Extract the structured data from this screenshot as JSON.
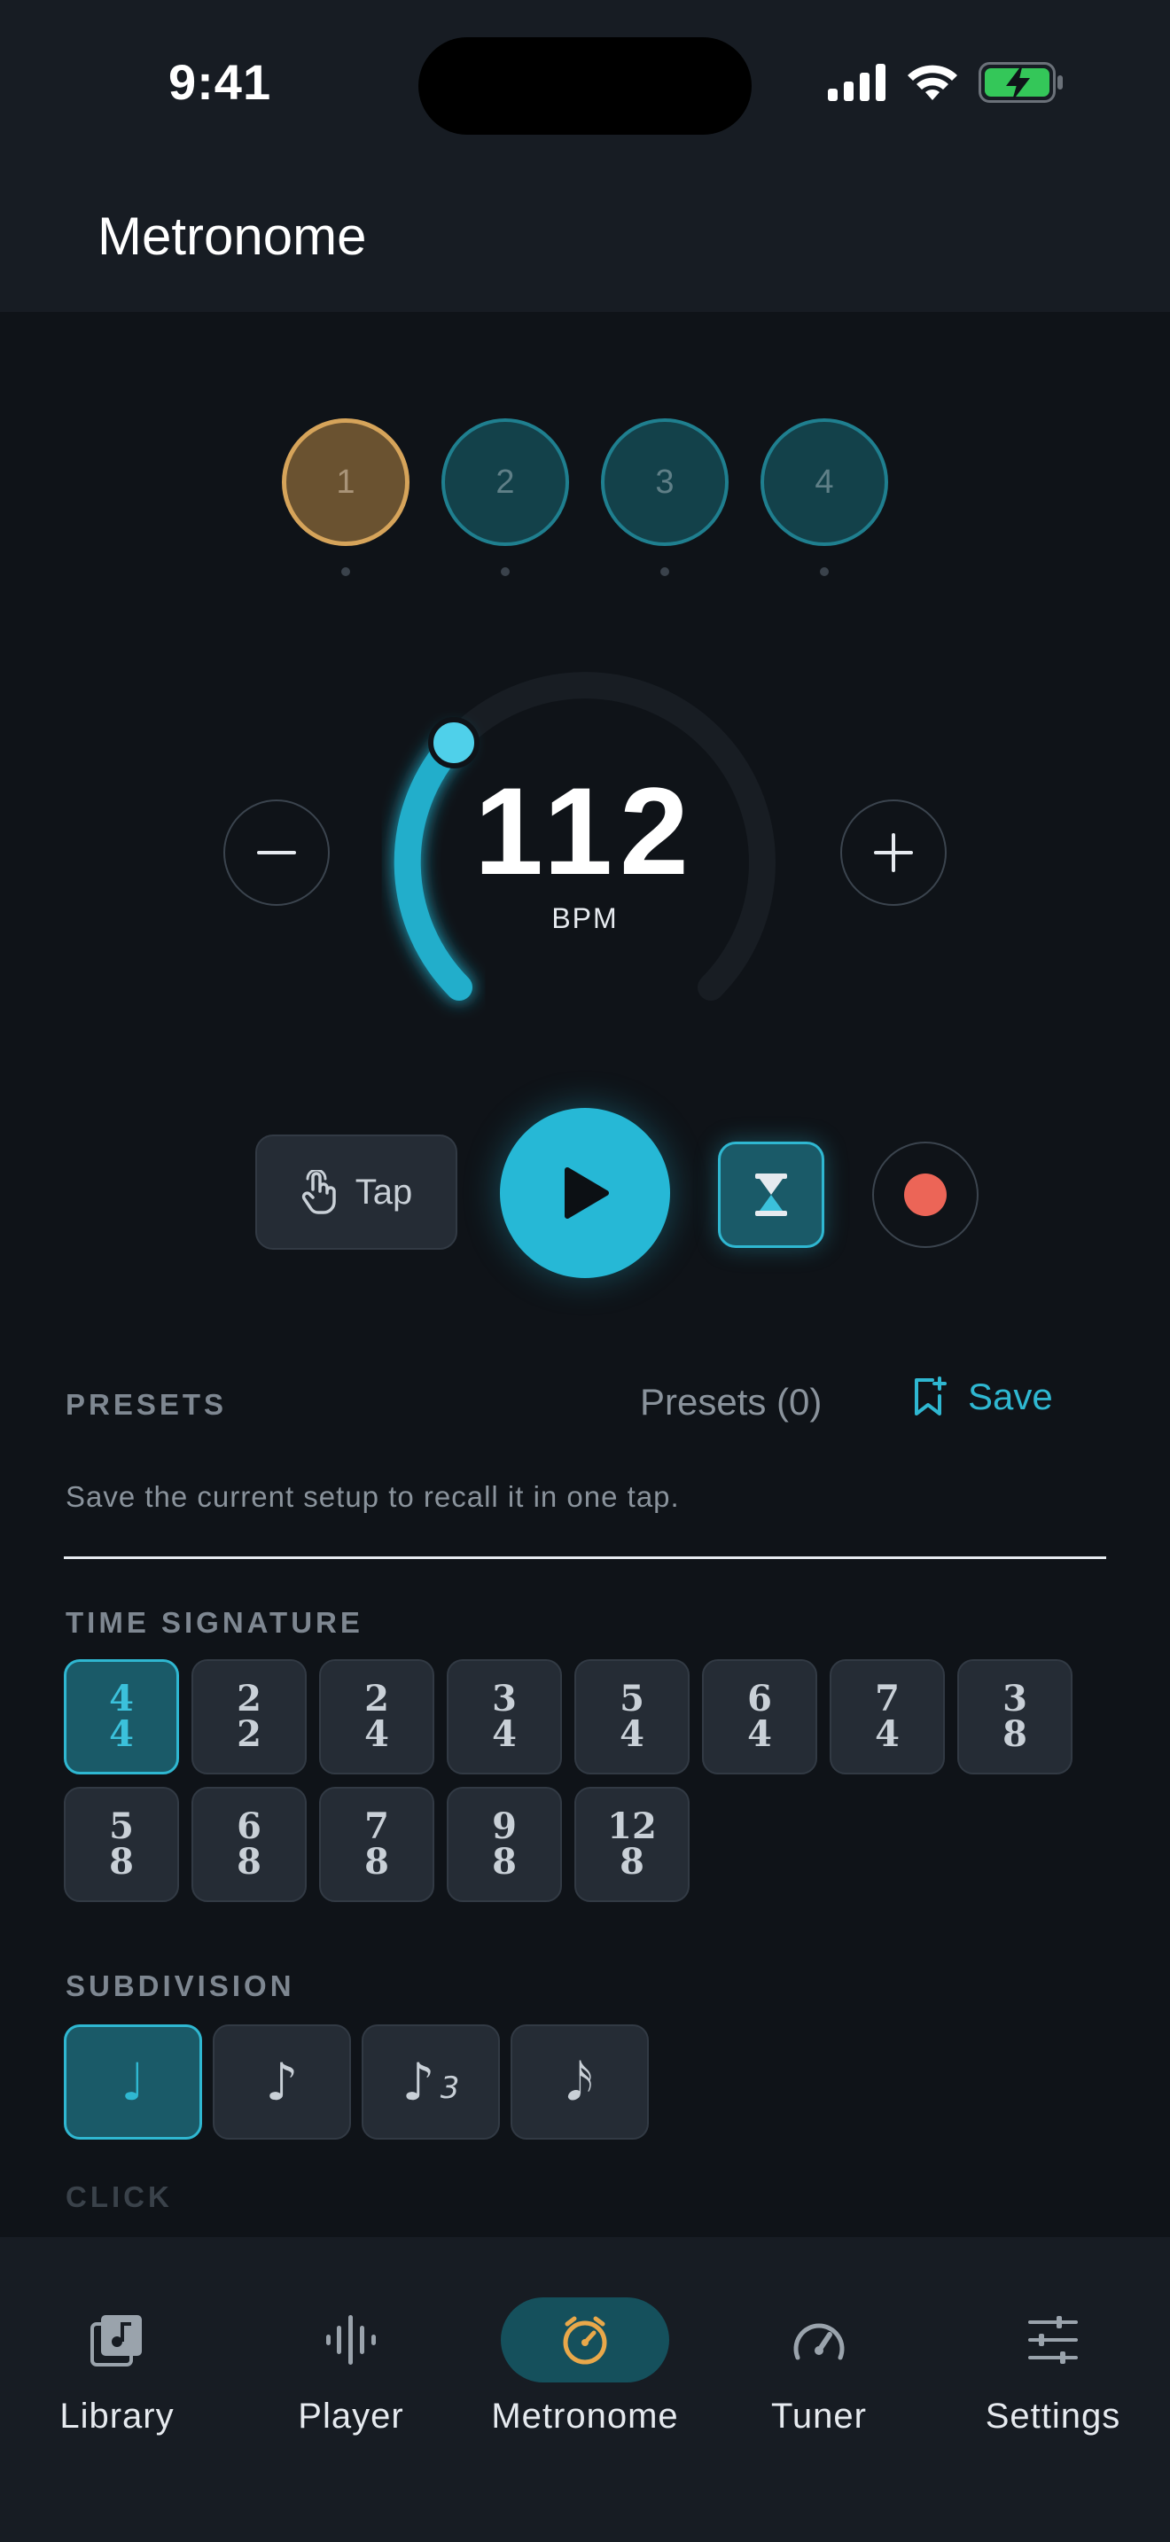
{
  "status": {
    "time": "9:41"
  },
  "header": {
    "title": "Metronome"
  },
  "beats": [
    {
      "label": "1",
      "accent": true
    },
    {
      "label": "2",
      "accent": false
    },
    {
      "label": "3",
      "accent": false
    },
    {
      "label": "4",
      "accent": false
    }
  ],
  "tempo": {
    "bpm": "112",
    "unit": "BPM"
  },
  "transport": {
    "tap_label": "Tap"
  },
  "presets": {
    "section_label": "PRESETS",
    "count_label": "Presets (0)",
    "save_label": "Save",
    "hint": "Save the current setup to recall it in one tap."
  },
  "time_signature": {
    "section_label": "TIME SIGNATURE",
    "options": [
      {
        "top": "4",
        "bottom": "4",
        "active": true
      },
      {
        "top": "2",
        "bottom": "2"
      },
      {
        "top": "2",
        "bottom": "4"
      },
      {
        "top": "3",
        "bottom": "4"
      },
      {
        "top": "5",
        "bottom": "4"
      },
      {
        "top": "6",
        "bottom": "4"
      },
      {
        "top": "7",
        "bottom": "4"
      },
      {
        "top": "3",
        "bottom": "8"
      },
      {
        "top": "5",
        "bottom": "8"
      },
      {
        "top": "6",
        "bottom": "8"
      },
      {
        "top": "7",
        "bottom": "8"
      },
      {
        "top": "9",
        "bottom": "8"
      },
      {
        "top": "12",
        "bottom": "8"
      }
    ]
  },
  "subdivision": {
    "section_label": "SUBDIVISION",
    "options": [
      {
        "glyph": "♩",
        "extra": "",
        "name": "quarter-note-icon",
        "active": true
      },
      {
        "glyph": "♪",
        "extra": "",
        "name": "eighth-note-icon"
      },
      {
        "glyph": "♪",
        "extra": "3",
        "name": "triplet-note-icon"
      },
      {
        "glyph": "𝅘𝅥𝅯",
        "extra": "",
        "name": "sixteenth-note-icon"
      }
    ]
  },
  "click": {
    "section_label": "CLICK"
  },
  "tabs": [
    {
      "label": "Library",
      "icon": "library-icon"
    },
    {
      "label": "Player",
      "icon": "waveform-icon"
    },
    {
      "label": "Metronome",
      "icon": "metronome-icon",
      "active": true
    },
    {
      "label": "Tuner",
      "icon": "gauge-icon"
    },
    {
      "label": "Settings",
      "icon": "sliders-icon"
    }
  ],
  "colors": {
    "accent": "#2fb7d1",
    "accent_beat": "#d6a45a",
    "record": "#ec6557",
    "metronome_tab_icon": "#e9a84a"
  }
}
